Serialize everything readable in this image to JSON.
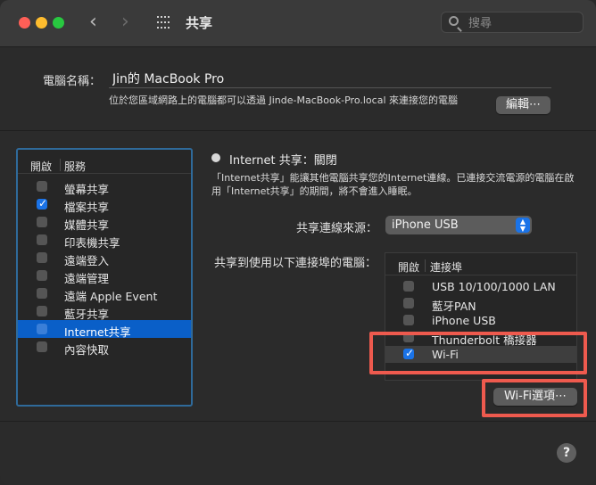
{
  "window": {
    "title": "共享",
    "search_placeholder": "搜尋"
  },
  "computer_name": {
    "label": "電腦名稱：",
    "value": "Jin的 MacBook Pro",
    "description": "位於您區域網路上的電腦都可以透過 Jinde-MacBook-Pro.local 來連接您的電腦",
    "edit_button": "編輯⋯"
  },
  "services": {
    "header_on": "開啟",
    "header_service": "服務",
    "items": [
      {
        "label": "螢幕共享",
        "checked": false,
        "selected": false
      },
      {
        "label": "檔案共享",
        "checked": true,
        "selected": false
      },
      {
        "label": "媒體共享",
        "checked": false,
        "selected": false
      },
      {
        "label": "印表機共享",
        "checked": false,
        "selected": false
      },
      {
        "label": "遠端登入",
        "checked": false,
        "selected": false
      },
      {
        "label": "遠端管理",
        "checked": false,
        "selected": false
      },
      {
        "label": "遠端 Apple Event",
        "checked": false,
        "selected": false
      },
      {
        "label": "藍牙共享",
        "checked": false,
        "selected": false
      },
      {
        "label": "Internet共享",
        "checked": false,
        "selected": true
      },
      {
        "label": "內容快取",
        "checked": false,
        "selected": false
      }
    ]
  },
  "detail": {
    "status": "Internet 共享：關閉",
    "description": "「Internet共享」能讓其他電腦共享您的Internet連線。已連接交流電源的電腦在啟用「Internet共享」的期間，將不會進入睡眠。",
    "source_label": "共享連線來源：",
    "source_value": "iPhone USB",
    "ports_label": "共享到使用以下連接埠的電腦：",
    "ports_header_on": "開啟",
    "ports_header_port": "連接埠",
    "ports": [
      {
        "label": "USB 10/100/1000 LAN",
        "checked": false,
        "selected": false
      },
      {
        "label": "藍牙PAN",
        "checked": false,
        "selected": false
      },
      {
        "label": "iPhone USB",
        "checked": false,
        "selected": false
      },
      {
        "label": "Thunderbolt 橋接器",
        "checked": false,
        "selected": false
      },
      {
        "label": "Wi-Fi",
        "checked": true,
        "selected": true
      }
    ],
    "wifi_options_button": "Wi-Fi選項⋯"
  },
  "help": "?",
  "colors": {
    "accent": "#1a73e8",
    "selection": "#0a5fc8",
    "highlight": "#ee5a4e"
  }
}
